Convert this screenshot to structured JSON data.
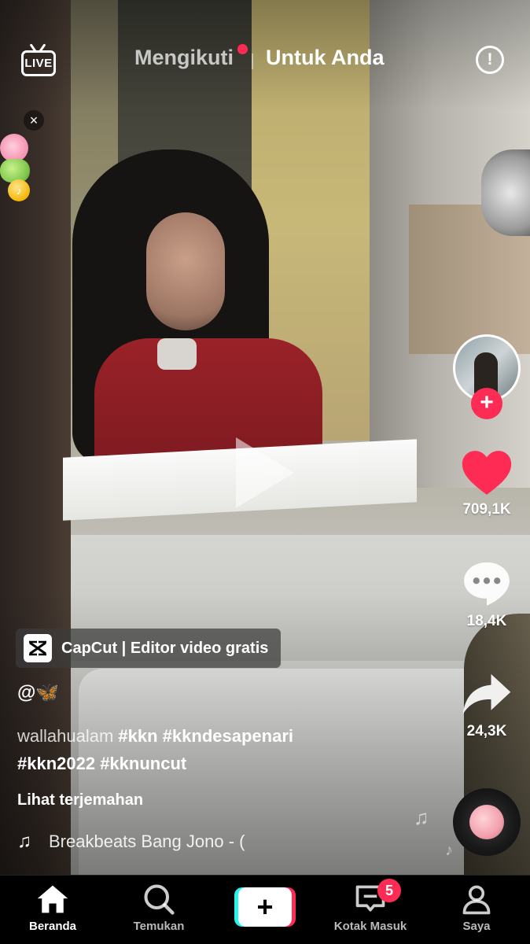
{
  "top_bar": {
    "live_label": "LIVE",
    "tab_following": "Mengikuti",
    "tab_for_you": "Untuk Anda",
    "info_glyph": "!"
  },
  "gift_widget": {
    "close_glyph": "×",
    "coin_glyph": "♪"
  },
  "actions": {
    "follow_glyph": "+",
    "likes": "709,1K",
    "comments": "18,4K",
    "shares": "24,3K"
  },
  "caption": {
    "capcut_label": "CapCut | Editor video gratis",
    "username_prefix": "@",
    "username_emoji": "🦋",
    "text": "wallahualam",
    "hashtags_line1": "#kkn #kkndesapenari",
    "hashtags_line2": "#kkn2022 #kknuncut",
    "translate_label": "Lihat terjemahan",
    "music_glyph": "♫",
    "music_title": "Breakbeats Bang Jono - ("
  },
  "nav": {
    "home": "Beranda",
    "discover": "Temukan",
    "create_glyph": "+",
    "inbox": "Kotak Masuk",
    "inbox_badge": "5",
    "me": "Saya"
  },
  "colors": {
    "accent_red": "#fe2c55",
    "accent_cyan": "#25f4ee",
    "heart": "#fe2c55"
  }
}
